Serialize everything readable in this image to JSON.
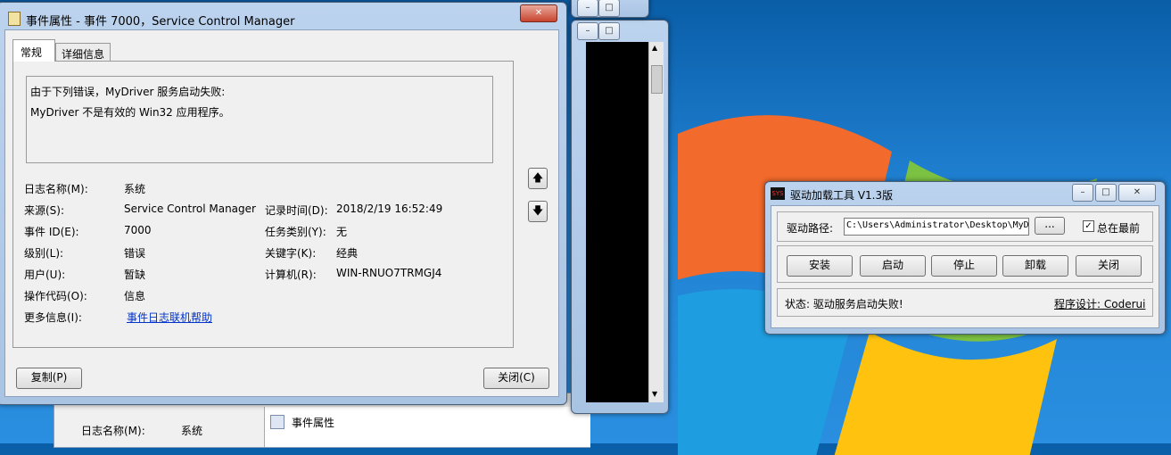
{
  "event_window": {
    "title": "事件属性 - 事件 7000，Service Control Manager",
    "tabs": [
      "常规",
      "详细信息"
    ],
    "message_line1": "由于下列错误，MyDriver 服务启动失败:",
    "message_line2": "MyDriver 不是有效的 Win32 应用程序。",
    "fields": {
      "log_name_label": "日志名称(M):",
      "log_name_value": "系统",
      "source_label": "来源(S):",
      "source_value": "Service Control Manager",
      "logged_label": "记录时间(D):",
      "logged_value": "2018/2/19 16:52:49",
      "event_id_label": "事件 ID(E):",
      "event_id_value": "7000",
      "task_label": "任务类别(Y):",
      "task_value": "无",
      "level_label": "级别(L):",
      "level_value": "错误",
      "keywords_label": "关键字(K):",
      "keywords_value": "经典",
      "user_label": "用户(U):",
      "user_value": "暂缺",
      "computer_label": "计算机(R):",
      "computer_value": "WIN-RNUO7TRMGJ4",
      "opcode_label": "操作代码(O):",
      "opcode_value": "信息",
      "more_info_label": "更多信息(I):",
      "more_info_link": "事件日志联机帮助"
    },
    "copy_button": "复制(P)",
    "close_button": "关闭(C)"
  },
  "background_window": {
    "log_name_label": "日志名称(M):",
    "log_name_value": "系统",
    "action_item": "事件属性"
  },
  "driver_tool": {
    "icon_text": "SYS",
    "title": "驱动加载工具 V1.3版",
    "path_label": "驱动路径:",
    "path_value": "C:\\Users\\Administrator\\Desktop\\MyD",
    "browse_label": "...",
    "always_on_top_label": "总在最前",
    "buttons": [
      "安装",
      "启动",
      "停止",
      "卸载",
      "关闭"
    ],
    "status_text": "状态: 驱动服务启动失败!",
    "designer_text": "程序设计: Coderui"
  },
  "colors": {
    "link": "#0033cc",
    "cmd_bg": "#000000",
    "desktop": "#1f7fd0"
  }
}
